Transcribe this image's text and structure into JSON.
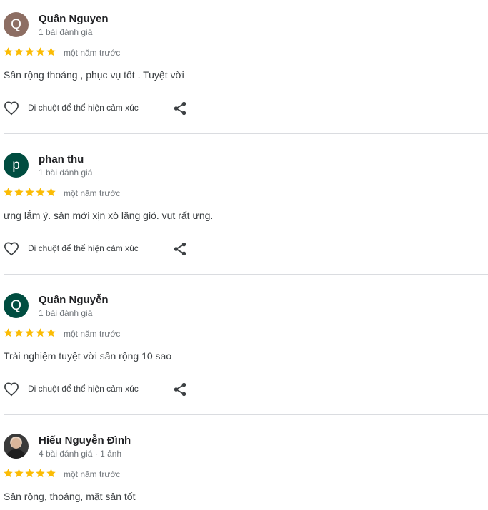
{
  "colors": {
    "star": "#fbbc04",
    "avatar_1": "#8d6e63",
    "avatar_2": "#004d40",
    "avatar_3": "#004d40",
    "divider": "#dadce0",
    "muted_text": "#70757a"
  },
  "icons": {
    "star": "star-icon",
    "react": "heart-outline-icon",
    "share": "share-icon"
  },
  "reviews": [
    {
      "avatar_letter": "Q",
      "name": "Quân Nguyen",
      "meta": "1 bài đánh giá",
      "rating": 5,
      "time": "một năm trước",
      "text": "Sân rộng thoáng , phục vụ tốt . Tuyệt vời",
      "react_label": "Di chuột để thể hiện cảm xúc"
    },
    {
      "avatar_letter": "p",
      "name": "phan thu",
      "meta": "1 bài đánh giá",
      "rating": 5,
      "time": "một năm trước",
      "text": "ưng lắm ý. sân mới xịn xò lặng gió. vụt rất ưng.",
      "react_label": "Di chuột để thể hiện cảm xúc"
    },
    {
      "avatar_letter": "Q",
      "name": "Quân Nguyễn",
      "meta": "1 bài đánh giá",
      "rating": 5,
      "time": "một năm trước",
      "text": "Trải nghiệm tuyệt vời sân rộng 10 sao",
      "react_label": "Di chuột để thể hiện cảm xúc"
    },
    {
      "avatar_letter": "",
      "name": "Hiếu Nguyễn Đình",
      "meta": "4 bài đánh giá · 1 ảnh",
      "rating": 5,
      "time": "một năm trước",
      "text": "Sân rộng, thoáng, mặt sân tốt",
      "react_label": ""
    }
  ]
}
